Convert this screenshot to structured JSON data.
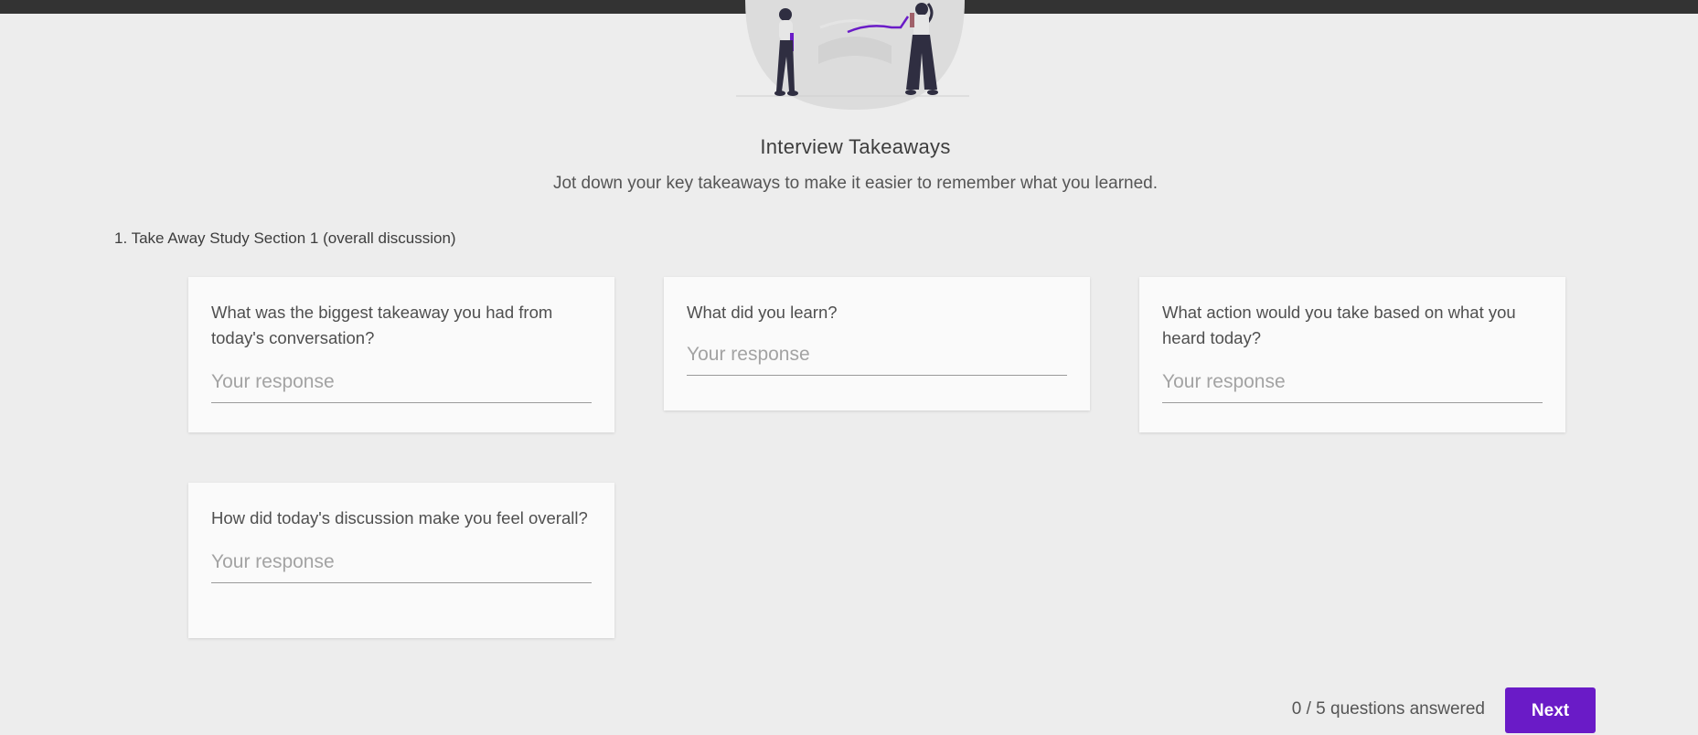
{
  "header": {
    "title": "Interview Takeaways",
    "subtitle": "Jot down your key takeaways to make it easier to remember what you learned."
  },
  "section": {
    "heading": "1. Take Away Study Section 1 (overall discussion)"
  },
  "cards": [
    {
      "question": "What was the biggest takeaway you had from today's conversation?",
      "placeholder": "Your response",
      "value": ""
    },
    {
      "question": "What did you learn?",
      "placeholder": "Your response",
      "value": ""
    },
    {
      "question": "What action would you take based on what you heard today?",
      "placeholder": "Your response",
      "value": ""
    },
    {
      "question": "How did today's discussion make you feel overall?",
      "placeholder": "Your response",
      "value": ""
    }
  ],
  "footer": {
    "progress": "0 / 5 questions answered",
    "next_label": "Next"
  },
  "colors": {
    "accent": "#6a1bc7",
    "background": "#ededed",
    "card": "#fafafa",
    "top_bar": "#333333"
  },
  "icons": {
    "illustration": "people-reading-illustration"
  }
}
